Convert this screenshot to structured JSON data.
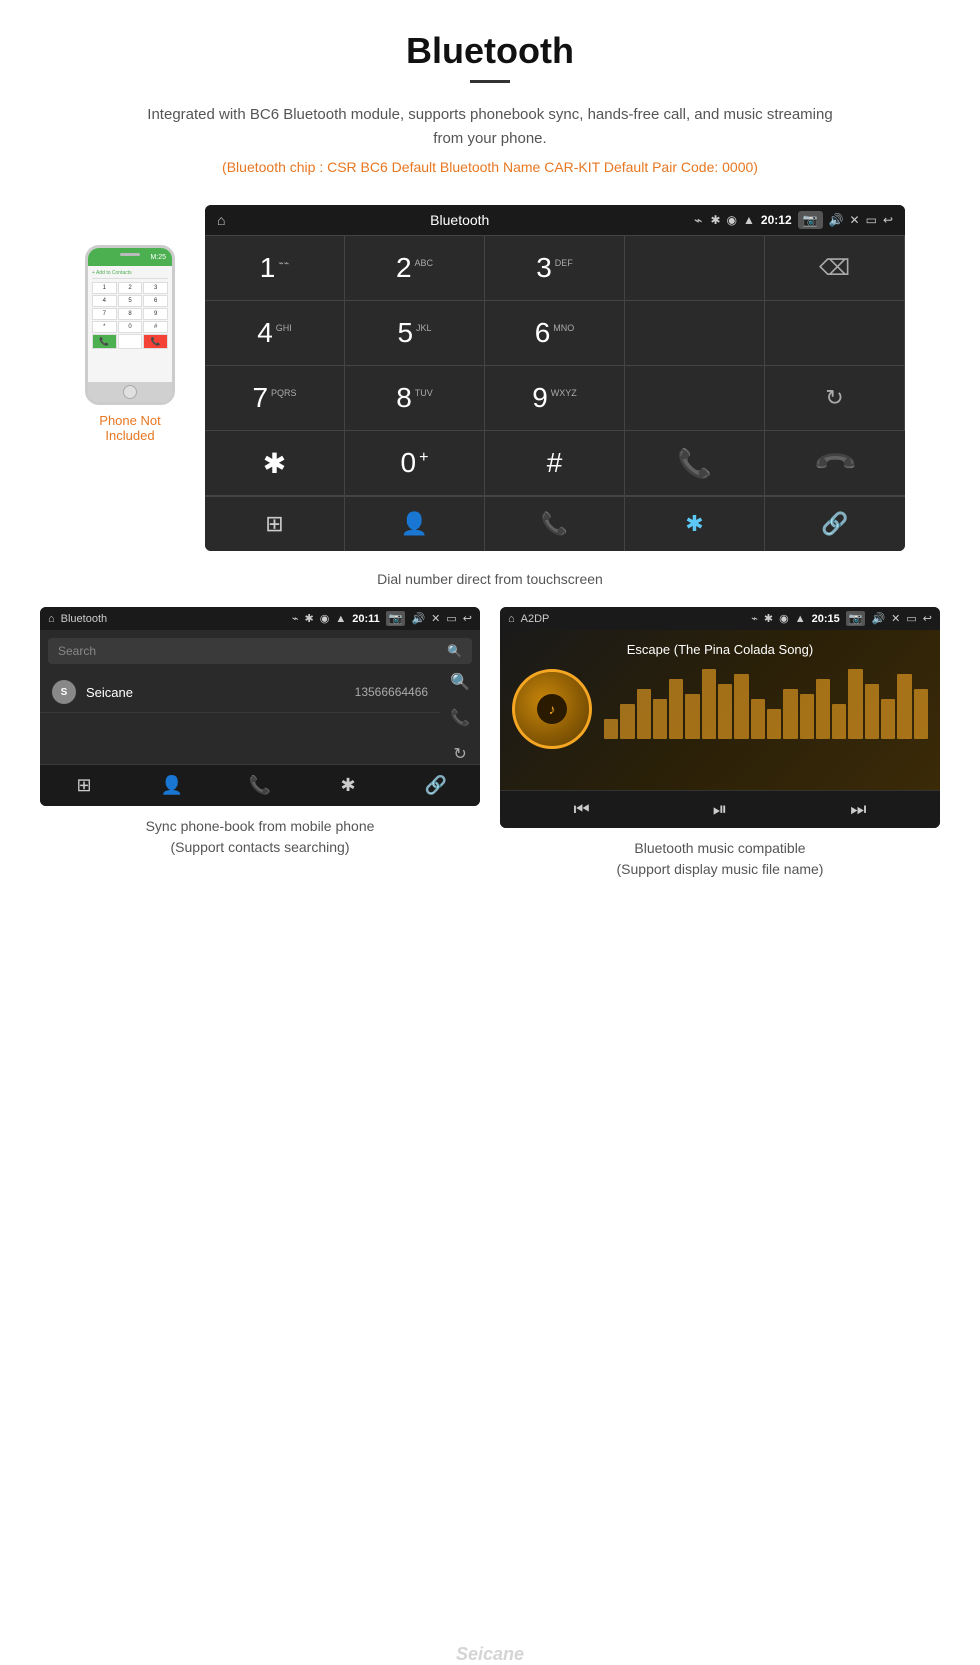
{
  "page": {
    "title": "Bluetooth",
    "description": "Integrated with BC6 Bluetooth module, supports phonebook sync, hands-free call, and music streaming from your phone.",
    "specs": "(Bluetooth chip : CSR BC6    Default Bluetooth Name CAR-KIT    Default Pair Code: 0000)"
  },
  "car_screen_dial": {
    "status_bar": {
      "home_icon": "⌂",
      "title": "Bluetooth",
      "usb_icon": "⌁",
      "bluetooth_icon": "⚡",
      "location_icon": "◉",
      "signal_icon": "▲",
      "time": "20:12",
      "camera_icon": "📷",
      "volume_icon": "🔊",
      "close_icon": "✕",
      "window_icon": "▭",
      "back_icon": "↩"
    },
    "keys": [
      {
        "number": "1",
        "sub": "⌁⌁"
      },
      {
        "number": "2",
        "sub": "ABC"
      },
      {
        "number": "3",
        "sub": "DEF"
      },
      {
        "number": "",
        "sub": ""
      },
      {
        "number": "⌫",
        "sub": ""
      },
      {
        "number": "4",
        "sub": "GHI"
      },
      {
        "number": "5",
        "sub": "JKL"
      },
      {
        "number": "6",
        "sub": "MNO"
      },
      {
        "number": "",
        "sub": ""
      },
      {
        "number": "",
        "sub": ""
      },
      {
        "number": "7",
        "sub": "PQRS"
      },
      {
        "number": "8",
        "sub": "TUV"
      },
      {
        "number": "9",
        "sub": "WXYZ"
      },
      {
        "number": "",
        "sub": ""
      },
      {
        "number": "↻",
        "sub": ""
      },
      {
        "number": "*",
        "sub": ""
      },
      {
        "number": "0⁺",
        "sub": ""
      },
      {
        "number": "#",
        "sub": ""
      },
      {
        "number": "📞",
        "sub": "green"
      },
      {
        "number": "📞",
        "sub": "red"
      }
    ],
    "nav_icons": [
      "⊞",
      "👤",
      "📞",
      "✱",
      "🔗"
    ]
  },
  "dial_caption": "Dial number direct from touchscreen",
  "phone": {
    "not_included_text": "Phone Not Included",
    "add_contact": "+ Add to Contacts",
    "number": "M:25",
    "keys": [
      "1",
      "2",
      "3",
      "4",
      "5",
      "6",
      "7",
      "8",
      "9",
      "*",
      "0",
      "#"
    ],
    "bottom_keys": [
      "green_call",
      "red_hang"
    ]
  },
  "phonebook_screen": {
    "status_bar": {
      "home_icon": "⌂",
      "title": "Bluetooth",
      "usb_icon": "⌁"
    },
    "time": "20:11",
    "search_placeholder": "Search",
    "contact": {
      "letter": "S",
      "name": "Seicane",
      "number": "13566664466"
    },
    "right_icons": [
      "🔍",
      "📞",
      "↻"
    ],
    "nav_icons": [
      "⊞",
      "👤",
      "📞",
      "✱",
      "🔗"
    ]
  },
  "music_screen": {
    "status_bar": {
      "home_icon": "⌂",
      "title": "A2DP"
    },
    "time": "20:15",
    "song_title": "Escape (The Pina Colada Song)",
    "controls": [
      "⏮",
      "⏯",
      "⏭"
    ],
    "bars": [
      20,
      35,
      50,
      40,
      60,
      45,
      70,
      55,
      65,
      40,
      30,
      50,
      45,
      60,
      35,
      70,
      55,
      40,
      65,
      50
    ]
  },
  "bottom_captions": {
    "left_line1": "Sync phone-book from mobile phone",
    "left_line2": "(Support contacts searching)",
    "right_line1": "Bluetooth music compatible",
    "right_line2": "(Support display music file name)"
  },
  "seicane_watermark": "Seicane"
}
